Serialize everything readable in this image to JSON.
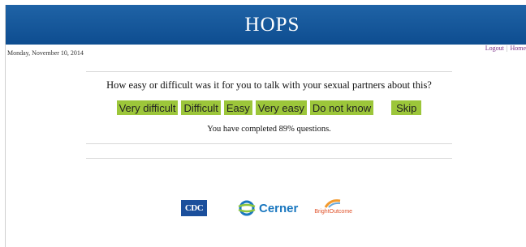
{
  "header": {
    "title": "HOPS"
  },
  "date": "Monday, November 10, 2014",
  "nav": {
    "logout": "Logout",
    "separator": "|",
    "home": "Home"
  },
  "survey": {
    "question": "How easy or difficult was it for you to talk with your sexual partners about this?",
    "answers": [
      "Very difficult",
      "Difficult",
      "Easy",
      "Very easy",
      "Do not know"
    ],
    "skip": "Skip",
    "progress_text": "You have completed 89% questions.",
    "progress_percent": 89
  },
  "footer": {
    "cdc": "CDC",
    "cerner": "Cerner",
    "brightoutcome": "BrightOutcome"
  },
  "colors": {
    "header_bg": "#1258a0",
    "answer_bg": "#9cc63a",
    "link": "#7b2f87",
    "cdc_blue": "#1b4f9c",
    "cerner_blue": "#1a77bf",
    "bright_orange": "#e0532b"
  }
}
